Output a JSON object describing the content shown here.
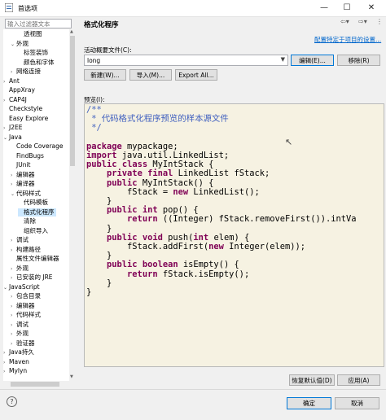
{
  "window": {
    "title": "首选项",
    "minimize": "—",
    "maximize": "☐",
    "close": "✕"
  },
  "left": {
    "filter_placeholder": "输入过滤器文本",
    "tree": [
      {
        "label": "透视图",
        "indent": 3,
        "twisty": ""
      },
      {
        "label": "外观",
        "indent": 2,
        "twisty": "v"
      },
      {
        "label": "标签装饰",
        "indent": 3,
        "twisty": ""
      },
      {
        "label": "颜色和字体",
        "indent": 3,
        "twisty": ""
      },
      {
        "label": "网络连接",
        "indent": 2,
        "twisty": ">"
      },
      {
        "label": "Ant",
        "indent": 1,
        "twisty": ">"
      },
      {
        "label": "AppXray",
        "indent": 1,
        "twisty": ""
      },
      {
        "label": "CAP4J",
        "indent": 1,
        "twisty": ">"
      },
      {
        "label": "Checkstyle",
        "indent": 1,
        "twisty": ""
      },
      {
        "label": "Easy Explore",
        "indent": 1,
        "twisty": ""
      },
      {
        "label": "J2EE",
        "indent": 1,
        "twisty": ">"
      },
      {
        "label": "Java",
        "indent": 1,
        "twisty": "v"
      },
      {
        "label": "Code Coverage",
        "indent": 2,
        "twisty": ""
      },
      {
        "label": "FindBugs",
        "indent": 2,
        "twisty": ""
      },
      {
        "label": "JUnit",
        "indent": 2,
        "twisty": ""
      },
      {
        "label": "编辑器",
        "indent": 2,
        "twisty": ">"
      },
      {
        "label": "编译器",
        "indent": 2,
        "twisty": ">"
      },
      {
        "label": "代码样式",
        "indent": 2,
        "twisty": "v"
      },
      {
        "label": "代码模板",
        "indent": 3,
        "twisty": ""
      },
      {
        "label": "格式化程序",
        "indent": 3,
        "twisty": "",
        "selected": true
      },
      {
        "label": "清除",
        "indent": 3,
        "twisty": ""
      },
      {
        "label": "组织导入",
        "indent": 3,
        "twisty": ""
      },
      {
        "label": "调试",
        "indent": 2,
        "twisty": ">"
      },
      {
        "label": "构建路径",
        "indent": 2,
        "twisty": ">"
      },
      {
        "label": "属性文件编辑器",
        "indent": 2,
        "twisty": ""
      },
      {
        "label": "外观",
        "indent": 2,
        "twisty": ">"
      },
      {
        "label": "已安装的 JRE",
        "indent": 2,
        "twisty": ">"
      },
      {
        "label": "JavaScript",
        "indent": 1,
        "twisty": "v"
      },
      {
        "label": "包含目录",
        "indent": 2,
        "twisty": ">"
      },
      {
        "label": "编辑器",
        "indent": 2,
        "twisty": ">"
      },
      {
        "label": "代码样式",
        "indent": 2,
        "twisty": ">"
      },
      {
        "label": "调试",
        "indent": 2,
        "twisty": ">"
      },
      {
        "label": "外观",
        "indent": 2,
        "twisty": ">"
      },
      {
        "label": "验证器",
        "indent": 2,
        "twisty": ">"
      },
      {
        "label": "Java持久",
        "indent": 1,
        "twisty": ">"
      },
      {
        "label": "Maven",
        "indent": 1,
        "twisty": ">"
      },
      {
        "label": "Mylyn",
        "indent": 1,
        "twisty": ">"
      }
    ]
  },
  "right": {
    "title": "格式化程序",
    "configure_link": "配置特定于项目的设置...",
    "profile_label": "活动概要文件(C):",
    "profile_value": "long",
    "buttons": {
      "edit": "编辑(E)...",
      "remove": "移除(R)",
      "new": "新建(W)...",
      "import": "导入(M)...",
      "export": "Export All..."
    },
    "preview_label": "预览(I):",
    "code": [
      "/**",
      " * 代码格式化程序预览的样本源文件",
      " */",
      "",
      "package mypackage;",
      "import java.util.LinkedList;",
      "public class MyIntStack {",
      "    private final LinkedList fStack;",
      "    public MyIntStack() {",
      "        fStack = new LinkedList();",
      "    }",
      "    public int pop() {",
      "        return ((Integer) fStack.removeFirst()).intVa",
      "    }",
      "    public void push(int elem) {",
      "        fStack.addFirst(new Integer(elem));",
      "    }",
      "    public boolean isEmpty() {",
      "        return fStack.isEmpty();",
      "    }",
      "}"
    ],
    "restore_defaults": "恢复默认值(D)",
    "apply": "应用(A)"
  },
  "footer": {
    "help": "?",
    "ok": "确定",
    "cancel": "取消"
  }
}
